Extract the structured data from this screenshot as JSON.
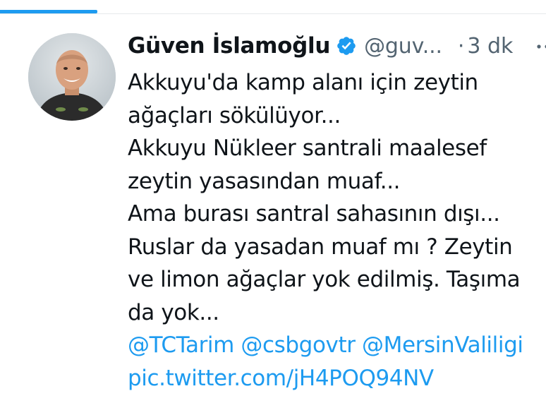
{
  "tweet": {
    "author": {
      "display_name": "Güven İslamoğlu",
      "handle": "@guv...",
      "verified": true
    },
    "separator": "·",
    "timestamp": "3 dk",
    "text_lines": [
      "Akkuyu'da kamp alanı için zeytin",
      "ağaçları sökülüyor...",
      "Akkuyu Nükleer santrali maalesef",
      "zeytin yasasından muaf...",
      "Ama burası santral sahasının dışı...",
      "Ruslar da yasadan muaf mı ? Zeytin",
      "ve limon ağaçlar yok edilmiş. Taşıma",
      "da yok..."
    ],
    "mentions": [
      "@TCTarim",
      "@csbgovtr",
      "@MersinValiligi"
    ],
    "media_link": "pic.twitter.com/jH4POQ94NV"
  },
  "icons": {
    "verified": "verified-badge-icon",
    "more": "more-options-icon"
  },
  "colors": {
    "accent": "#1d9bf0",
    "text": "#0f1419",
    "secondary_text": "#536471"
  }
}
